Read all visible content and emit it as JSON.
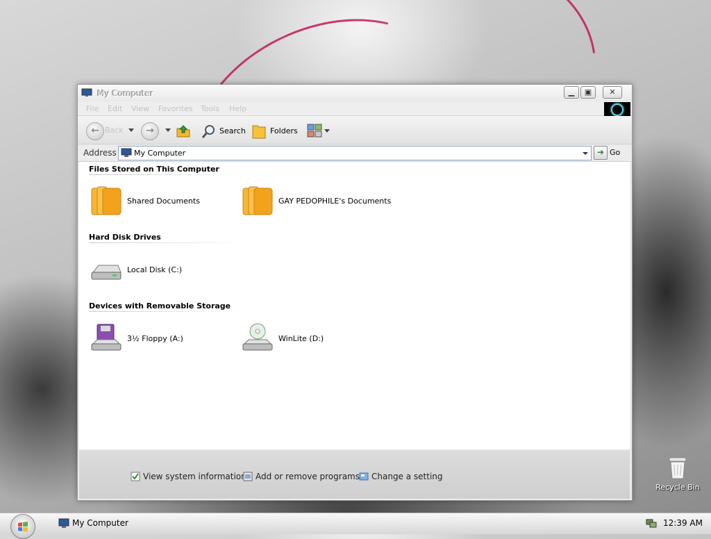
{
  "window": {
    "title": "My Computer",
    "menu": [
      "File",
      "Edit",
      "View",
      "Favorites",
      "Tools",
      "Help"
    ],
    "toolbar": {
      "back_label": "Back",
      "search_label": "Search",
      "folders_label": "Folders"
    },
    "address": {
      "label": "Address",
      "value": "My Computer",
      "go_label": "Go"
    },
    "groups": [
      {
        "title": "Files Stored on This Computer",
        "items": [
          "Shared Documents",
          "GAY PEDOPHILE's Documents"
        ]
      },
      {
        "title": "Hard Disk Drives",
        "items": [
          "Local Disk (C:)"
        ]
      },
      {
        "title": "Devices with Removable Storage",
        "items": [
          "3½ Floppy (A:)",
          "WinLite (D:)"
        ]
      }
    ],
    "tasks": [
      "View system information",
      "Add or remove programs",
      "Change a setting"
    ]
  },
  "desktop": {
    "recycle_bin_label": "Recycle Bin"
  },
  "taskbar": {
    "task_label": "My Computer",
    "clock": "12:39 AM"
  },
  "colors": {
    "accent_pink": "#c2185b",
    "folder": "#f3a21b",
    "throbber_ring": "#5fd8e6"
  },
  "icons": [
    "computer-icon",
    "minimize-icon",
    "maximize-icon",
    "close-icon",
    "back-arrow-icon",
    "forward-arrow-icon",
    "up-folder-icon",
    "search-icon",
    "folders-icon",
    "views-icon",
    "go-arrow-icon",
    "folder-icon",
    "hard-disk-icon",
    "floppy-icon",
    "cd-drive-icon",
    "system-info-icon",
    "programs-icon",
    "control-panel-icon",
    "recycle-bin-icon",
    "windows-start-icon",
    "network-tray-icon"
  ]
}
